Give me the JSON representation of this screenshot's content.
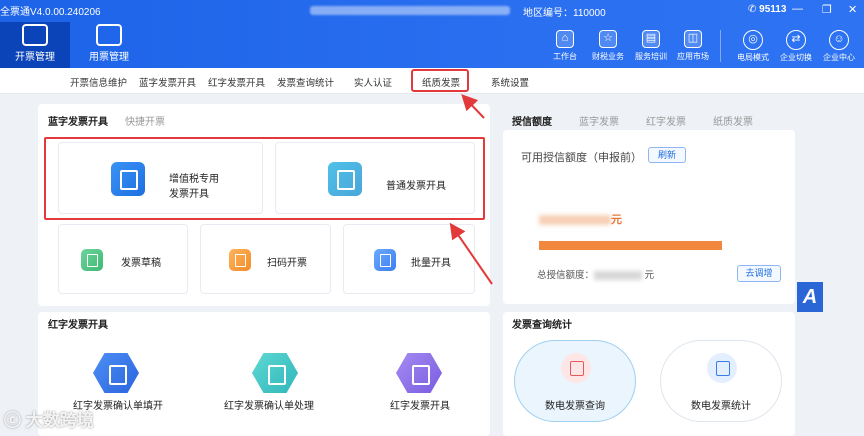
{
  "window": {
    "title": "全票通V4.0.00.240206",
    "region_label": "地区编号：110000",
    "hotline": "95113",
    "controls": [
      "—",
      "❐",
      "✕"
    ]
  },
  "nav": {
    "tabs": [
      {
        "label": "开票管理",
        "active": true
      },
      {
        "label": "用票管理",
        "active": false
      }
    ],
    "quick_links": [
      {
        "label": "工作台",
        "icon": "home-icon"
      },
      {
        "label": "财税业务",
        "icon": "finance-icon"
      },
      {
        "label": "服务培训",
        "icon": "training-icon"
      },
      {
        "label": "应用市场",
        "icon": "market-icon"
      },
      {
        "label": "电局模式",
        "icon": "tax-mode-icon"
      },
      {
        "label": "企业切换",
        "icon": "switch-icon"
      },
      {
        "label": "企业中心",
        "icon": "user-icon"
      }
    ]
  },
  "submenu": {
    "items": [
      "开票信息维护",
      "蓝字发票开具",
      "红字发票开具",
      "发票查询统计",
      "实人认证",
      "纸质发票",
      "系统设置"
    ],
    "highlighted": "纸质发票"
  },
  "blue_invoice": {
    "title": "蓝字发票开具",
    "tab_quick": "快捷开票",
    "vat_special_line1": "增值税专用",
    "vat_special_line2": "发票开具",
    "general_invoice": "普通发票开具",
    "draft": "发票草稿",
    "scan": "扫码开票",
    "batch": "批量开具"
  },
  "credit": {
    "tabs": [
      "授信额度",
      "蓝字发票",
      "红字发票",
      "纸质发票"
    ],
    "available_label": "可用授信额度（申报前）",
    "refresh_button": "刷新",
    "amount_suffix": "元",
    "total_label": "总授信额度：",
    "total_suffix": "元",
    "adjust_button": "去调增",
    "bar_color": "#f1883e"
  },
  "red_invoice": {
    "title": "红字发票开具",
    "confirm_fill": "红字发票确认单填开",
    "confirm_process": "红字发票确认单处理",
    "issue": "红字发票开具"
  },
  "query_stats": {
    "title": "发票查询统计",
    "query": "数电发票查询",
    "stats": "数电发票统计"
  },
  "watermark": "大数跨境",
  "corner_logo": "A",
  "colors": {
    "primary": "#1c63e8",
    "highlight_red": "#e23a3a"
  }
}
